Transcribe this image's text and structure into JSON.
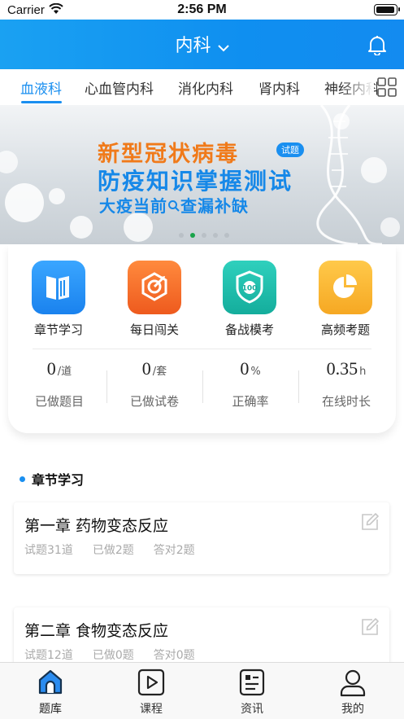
{
  "status_bar": {
    "carrier": "Carrier",
    "time": "2:56 PM"
  },
  "header": {
    "title": "内科",
    "dropdown_icon": "chevron-down-icon",
    "bell_icon": "bell-icon"
  },
  "tabs": {
    "items": [
      {
        "label": "血液科",
        "active": true
      },
      {
        "label": "心血管内科",
        "active": false
      },
      {
        "label": "消化内科",
        "active": false
      },
      {
        "label": "肾内科",
        "active": false
      },
      {
        "label": "神经内科",
        "active": false
      }
    ],
    "grid_icon": "grid-icon"
  },
  "banner": {
    "line1": "新型冠状病毒",
    "badge": "试题",
    "line2": "防疫知识掌握测试",
    "line3": "大疫当前",
    "line3b": "查漏补缺",
    "slide_count": 5,
    "active_slide": 2
  },
  "features": [
    {
      "label": "章节学习",
      "icon": "book-icon",
      "color": "#1e8ef2"
    },
    {
      "label": "每日闯关",
      "icon": "target-icon",
      "color": "#f46a2a"
    },
    {
      "label": "备战模考",
      "icon": "shield-100-icon",
      "color": "#1cb8a8"
    },
    {
      "label": "高频考题",
      "icon": "pie-chart-icon",
      "color": "#f8b430"
    }
  ],
  "stats": [
    {
      "value": "0",
      "unit": "/道",
      "label": "已做题目"
    },
    {
      "value": "0",
      "unit": "/套",
      "label": "已做试卷"
    },
    {
      "value": "0",
      "unit": "%",
      "label": "正确率"
    },
    {
      "value": "0.35",
      "unit": "h",
      "label": "在线时长"
    }
  ],
  "section": {
    "title": "章节学习"
  },
  "chapters": [
    {
      "title": "第一章 药物变态反应",
      "total": "试题31道",
      "done": "已做2题",
      "correct": "答对2题"
    },
    {
      "title": "第二章 食物变态反应",
      "total": "试题12道",
      "done": "已做0题",
      "correct": "答对0题"
    }
  ],
  "tabbar": [
    {
      "label": "题库",
      "icon": "home-icon",
      "active": true
    },
    {
      "label": "课程",
      "icon": "play-icon",
      "active": false
    },
    {
      "label": "资讯",
      "icon": "news-icon",
      "active": false
    },
    {
      "label": "我的",
      "icon": "user-icon",
      "active": false
    }
  ]
}
